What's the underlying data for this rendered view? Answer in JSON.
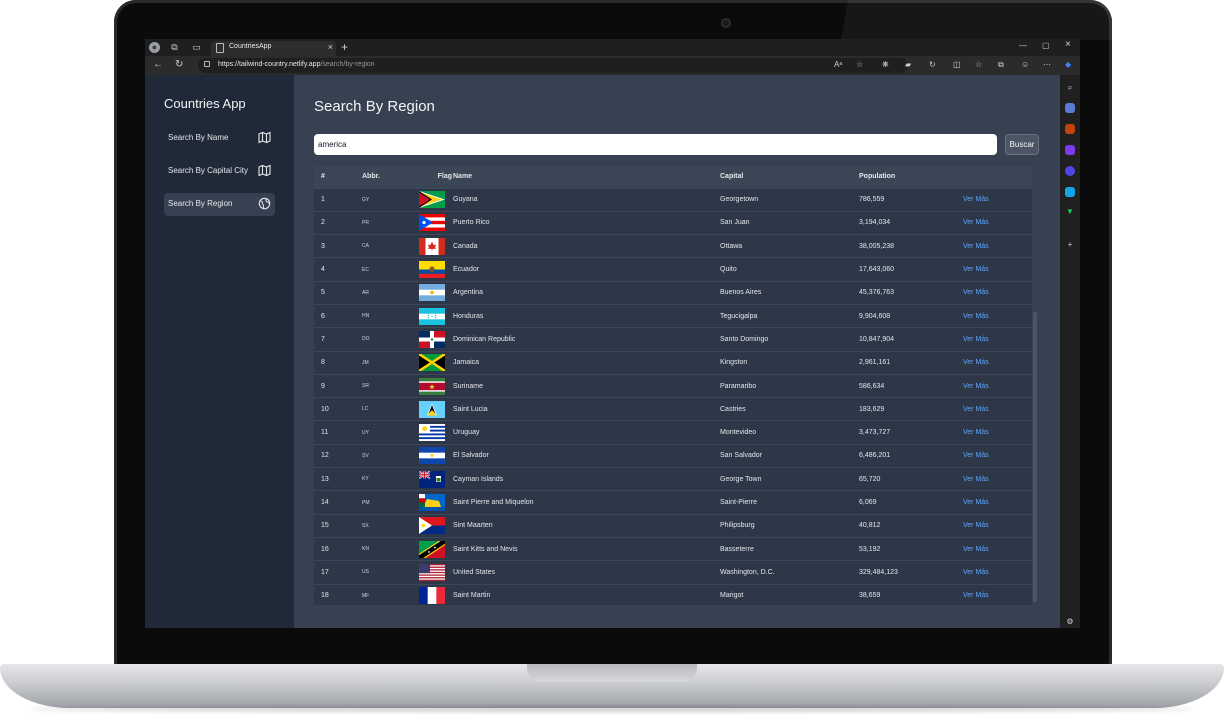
{
  "browser": {
    "tab_title": "CountriesApp",
    "url_host": "https://tailwind-country.netlify.app",
    "url_path": "/search/by-region"
  },
  "sidebar": {
    "title": "Countries App",
    "items": [
      {
        "label": "Search By Name",
        "active": false,
        "icon": "map-icon"
      },
      {
        "label": "Search By Capital City",
        "active": false,
        "icon": "map-icon"
      },
      {
        "label": "Search By Region",
        "active": true,
        "icon": "globe-icon"
      }
    ]
  },
  "main": {
    "title": "Search By Region",
    "search_value": "america",
    "search_button": "Buscar",
    "columns": [
      "#",
      "Abbr.",
      "Flag",
      "Name",
      "Capital",
      "Population",
      ""
    ],
    "link_label": "Ver Más",
    "rows": [
      {
        "n": "1",
        "abbr": "GY",
        "flag": "GY",
        "name": "Guyana",
        "capital": "Georgetown",
        "population": "786,559"
      },
      {
        "n": "2",
        "abbr": "PR",
        "flag": "PR",
        "name": "Puerto Rico",
        "capital": "San Juan",
        "population": "3,194,034"
      },
      {
        "n": "3",
        "abbr": "CA",
        "flag": "CA",
        "name": "Canada",
        "capital": "Ottawa",
        "population": "38,005,238"
      },
      {
        "n": "4",
        "abbr": "EC",
        "flag": "EC",
        "name": "Ecuador",
        "capital": "Quito",
        "population": "17,643,060"
      },
      {
        "n": "5",
        "abbr": "AR",
        "flag": "AR",
        "name": "Argentina",
        "capital": "Buenos Aires",
        "population": "45,376,763"
      },
      {
        "n": "6",
        "abbr": "HN",
        "flag": "HN",
        "name": "Honduras",
        "capital": "Tegucigalpa",
        "population": "9,904,608"
      },
      {
        "n": "7",
        "abbr": "DO",
        "flag": "DO",
        "name": "Dominican Republic",
        "capital": "Santo Domingo",
        "population": "10,847,904"
      },
      {
        "n": "8",
        "abbr": "JM",
        "flag": "JM",
        "name": "Jamaica",
        "capital": "Kingston",
        "population": "2,961,161"
      },
      {
        "n": "9",
        "abbr": "SR",
        "flag": "SR",
        "name": "Suriname",
        "capital": "Paramaribo",
        "population": "586,634"
      },
      {
        "n": "10",
        "abbr": "LC",
        "flag": "LC",
        "name": "Saint Lucia",
        "capital": "Castries",
        "population": "183,629"
      },
      {
        "n": "11",
        "abbr": "UY",
        "flag": "UY",
        "name": "Uruguay",
        "capital": "Montevideo",
        "population": "3,473,727"
      },
      {
        "n": "12",
        "abbr": "SV",
        "flag": "SV",
        "name": "El Salvador",
        "capital": "San Salvador",
        "population": "6,486,201"
      },
      {
        "n": "13",
        "abbr": "KY",
        "flag": "KY",
        "name": "Cayman Islands",
        "capital": "George Town",
        "population": "65,720"
      },
      {
        "n": "14",
        "abbr": "PM",
        "flag": "PM",
        "name": "Saint Pierre and Miquelon",
        "capital": "Saint-Pierre",
        "population": "6,069"
      },
      {
        "n": "15",
        "abbr": "SX",
        "flag": "SX",
        "name": "Sint Maarten",
        "capital": "Philipsburg",
        "population": "40,812"
      },
      {
        "n": "16",
        "abbr": "KN",
        "flag": "KN",
        "name": "Saint Kitts and Nevis",
        "capital": "Basseterre",
        "population": "53,192"
      },
      {
        "n": "17",
        "abbr": "US",
        "flag": "US",
        "name": "United States",
        "capital": "Washington, D.C.",
        "population": "329,484,123"
      },
      {
        "n": "18",
        "abbr": "MF",
        "flag": "MF",
        "name": "Saint Martin",
        "capital": "Marigot",
        "population": "38,659"
      }
    ]
  },
  "colors": {
    "sidebar_bg": "#1f2937",
    "content_bg": "#374151",
    "link": "#60a5fa"
  }
}
